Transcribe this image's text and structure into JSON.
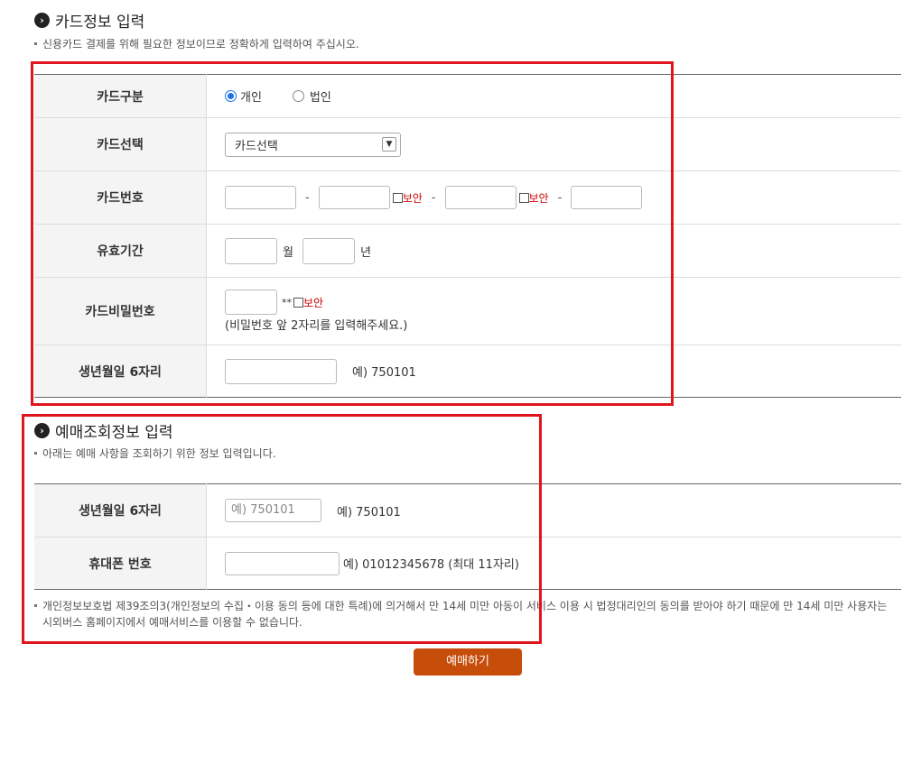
{
  "card_section": {
    "title": "카드정보 입력",
    "note": "신용카드 결제를 위해 필요한 정보이므로 정확하게 입력하여 주십시오.",
    "card_type": {
      "label": "카드구분",
      "options": [
        "개인",
        "법인"
      ],
      "selected": "개인"
    },
    "card_select": {
      "label": "카드선택",
      "value": "카드선택"
    },
    "card_number": {
      "label": "카드번호",
      "security_label": "보안",
      "separator": "-"
    },
    "expiry": {
      "label": "유효기간",
      "month_label": "월",
      "year_label": "년"
    },
    "card_password": {
      "label": "카드비밀번호",
      "mask": "**",
      "security_label": "보안",
      "hint": "(비밀번호 앞 2자리를 입력해주세요.)"
    },
    "birth": {
      "label": "생년월일 6자리",
      "example": "예) 750101"
    }
  },
  "lookup_section": {
    "title": "예매조회정보 입력",
    "note": "아래는 예매 사항을 조회하기 위한 정보 입력입니다.",
    "birth": {
      "label": "생년월일 6자리",
      "placeholder": "예) 750101",
      "example": "예) 750101"
    },
    "phone": {
      "label": "휴대폰 번호",
      "example": "예) 01012345678 (최대 11자리)"
    }
  },
  "privacy_note": "개인정보보호법 제39조의3(개인정보의 수집・이용 동의 등에 대한 특례)에 의거해서 만 14세 미만 아동이 서비스 이용 시 법정대리인의 동의를 받아야 하기 때문에 만 14세 미만 사용자는 시외버스 홈페이지에서 예매서비스를 이용할 수 없습니다.",
  "submit_label": "예매하기",
  "colors": {
    "highlight": "#e0161e",
    "button": "#c64d0a",
    "security_text": "#cc0000",
    "radio_selected": "#1a73e8"
  }
}
